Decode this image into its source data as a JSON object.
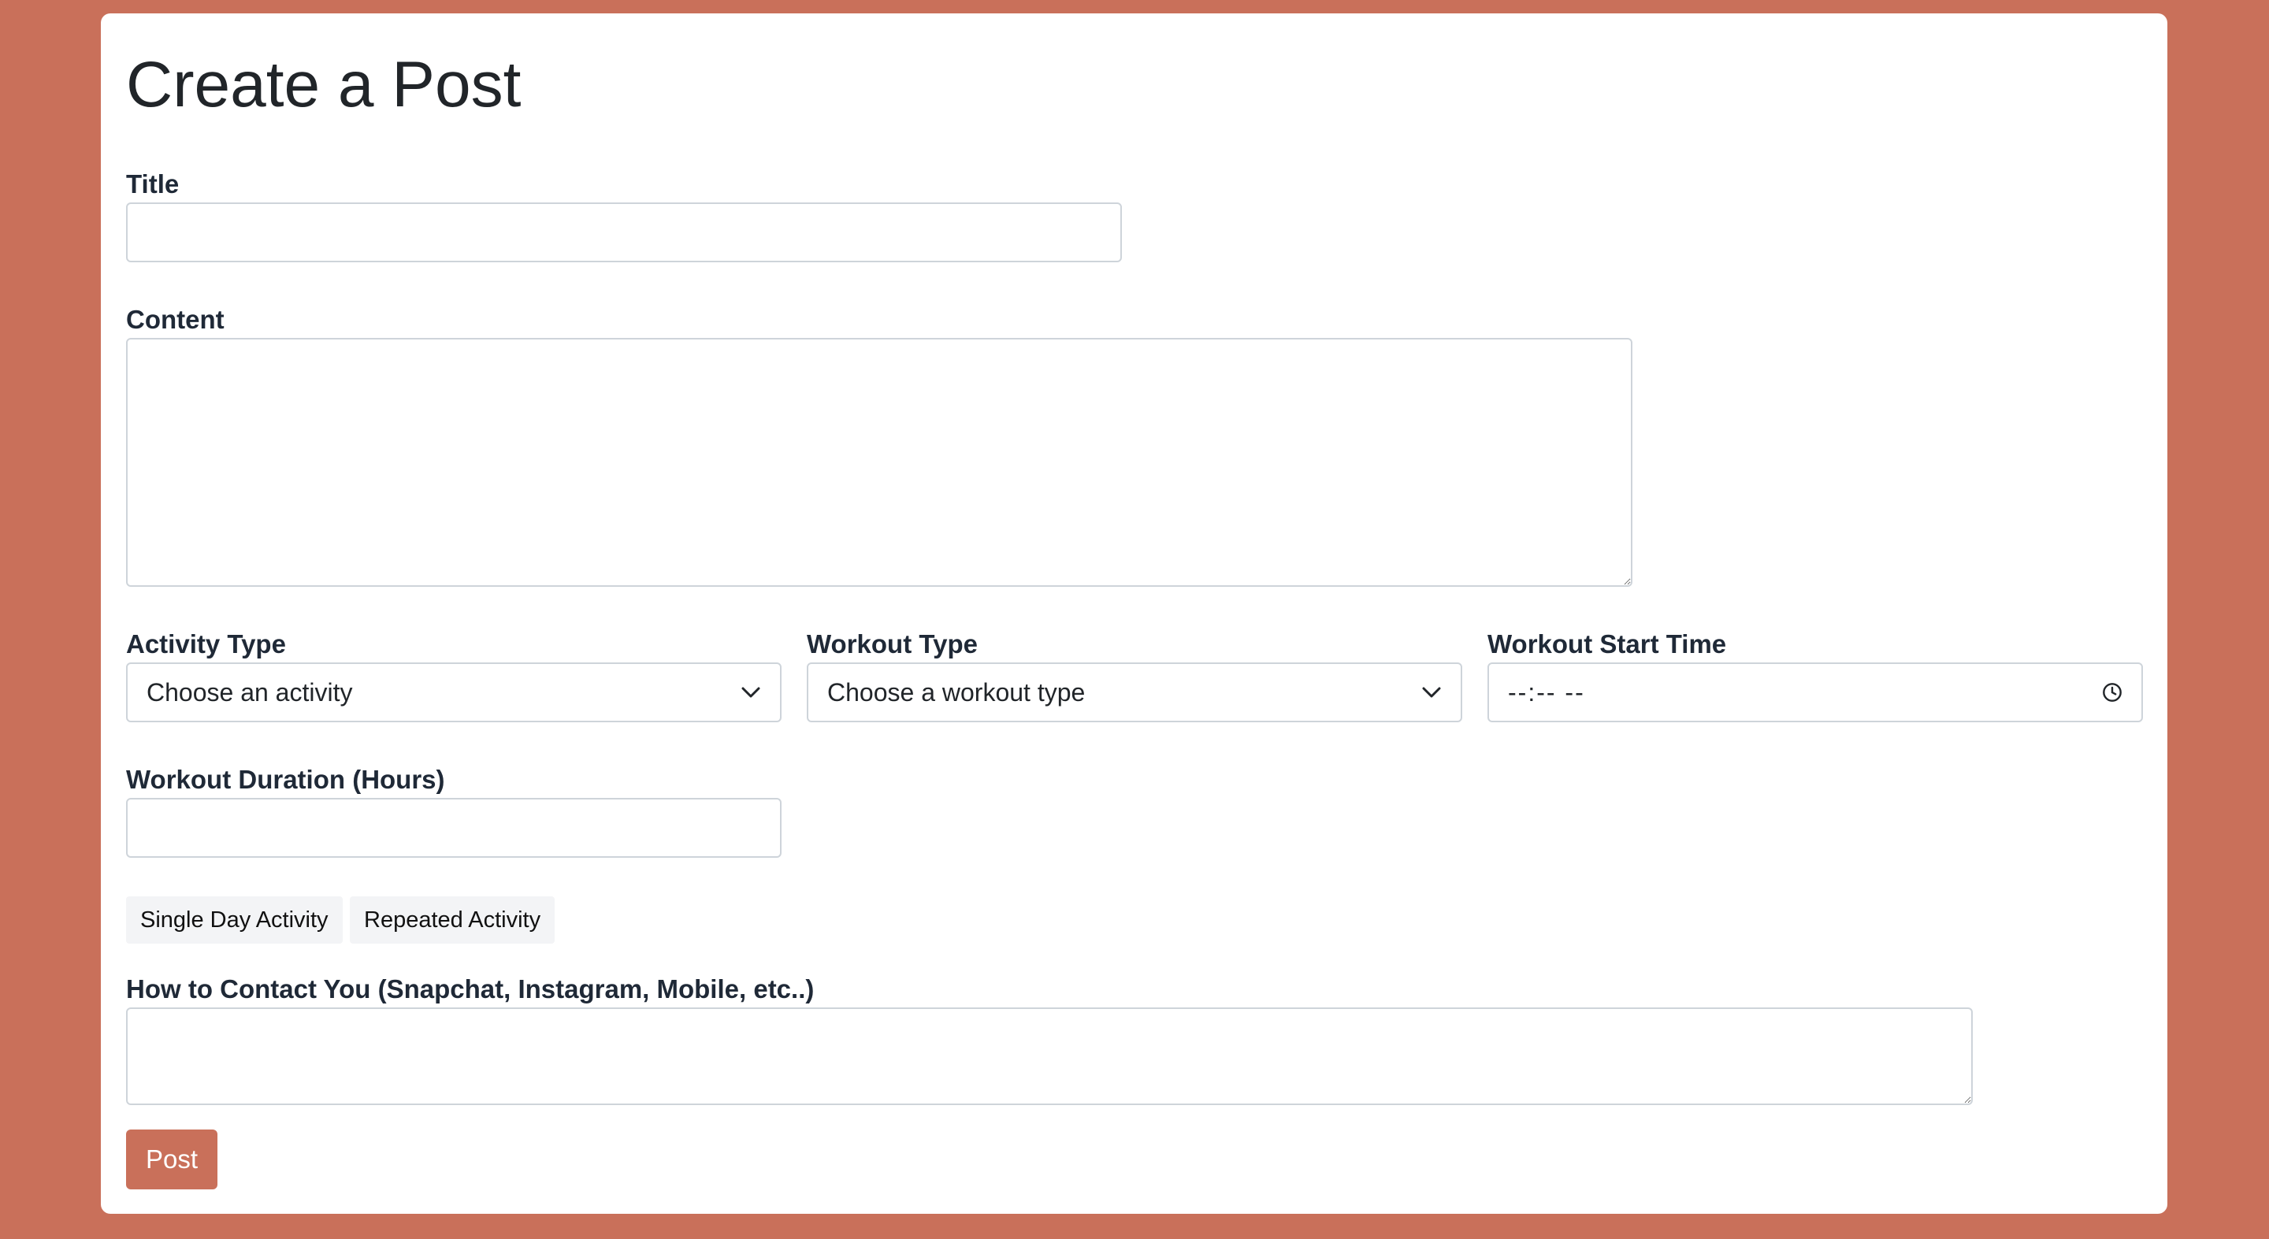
{
  "page": {
    "title": "Create a Post",
    "background_color": "#c9705a",
    "accent_color": "#c9705a"
  },
  "form": {
    "title": {
      "label": "Title",
      "value": ""
    },
    "content": {
      "label": "Content",
      "value": ""
    },
    "activity_type": {
      "label": "Activity Type",
      "selected": "Choose an activity",
      "icon": "chevron-down-icon"
    },
    "workout_type": {
      "label": "Workout Type",
      "selected": "Choose a workout type",
      "icon": "chevron-down-icon"
    },
    "workout_start_time": {
      "label": "Workout Start Time",
      "value": "--:-- --",
      "icon": "clock-icon"
    },
    "workout_duration": {
      "label": "Workout Duration (Hours)",
      "value": ""
    },
    "frequency_buttons": [
      {
        "label": "Single Day Activity"
      },
      {
        "label": "Repeated Activity"
      }
    ],
    "contact": {
      "label": "How to Contact You (Snapchat, Instagram, Mobile, etc..)",
      "value": ""
    },
    "submit_label": "Post"
  }
}
